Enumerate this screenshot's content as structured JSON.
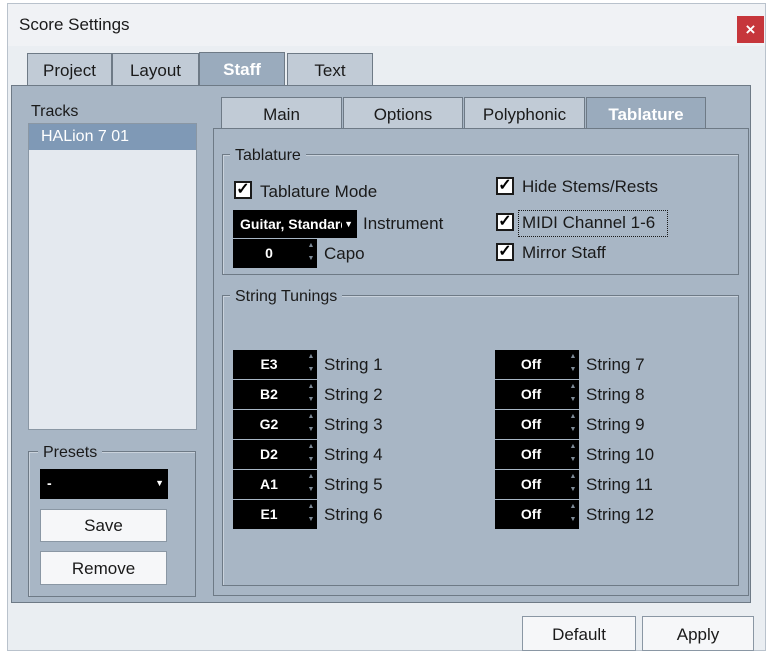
{
  "window": {
    "title": "Score Settings",
    "close_glyph": "×"
  },
  "outer_tabs": [
    {
      "label": "Project"
    },
    {
      "label": "Layout"
    },
    {
      "label": "Staff"
    },
    {
      "label": "Text"
    }
  ],
  "tracks": {
    "label": "Tracks",
    "items": [
      "HALion 7 01"
    ]
  },
  "presets": {
    "label": "Presets",
    "selected": "-",
    "save_label": "Save",
    "remove_label": "Remove"
  },
  "inner_tabs": [
    {
      "label": "Main"
    },
    {
      "label": "Options"
    },
    {
      "label": "Polyphonic"
    },
    {
      "label": "Tablature"
    }
  ],
  "tablature": {
    "group_label": "Tablature",
    "tablature_mode": {
      "label": "Tablature Mode",
      "checked": true
    },
    "instrument": {
      "value": "Guitar, Standard",
      "label": "Instrument"
    },
    "capo": {
      "value": "0",
      "label": "Capo"
    },
    "hide_stems": {
      "label": "Hide Stems/Rests",
      "checked": true
    },
    "midi_channel": {
      "label": "MIDI Channel 1-6",
      "checked": true
    },
    "mirror_staff": {
      "label": "Mirror Staff",
      "checked": true
    }
  },
  "string_tunings": {
    "group_label": "String Tunings",
    "strings": [
      {
        "value": "E3",
        "label": "String 1"
      },
      {
        "value": "B2",
        "label": "String 2"
      },
      {
        "value": "G2",
        "label": "String 3"
      },
      {
        "value": "D2",
        "label": "String 4"
      },
      {
        "value": "A1",
        "label": "String 5"
      },
      {
        "value": "E1",
        "label": "String 6"
      },
      {
        "value": "Off",
        "label": "String 7"
      },
      {
        "value": "Off",
        "label": "String 8"
      },
      {
        "value": "Off",
        "label": "String 9"
      },
      {
        "value": "Off",
        "label": "String 10"
      },
      {
        "value": "Off",
        "label": "String 11"
      },
      {
        "value": "Off",
        "label": "String 12"
      }
    ]
  },
  "footer": {
    "default_label": "Default",
    "apply_label": "Apply"
  },
  "icons": {
    "check": "✓",
    "dropdown": "▼",
    "spin_up": "▲",
    "spin_down": "▼"
  }
}
